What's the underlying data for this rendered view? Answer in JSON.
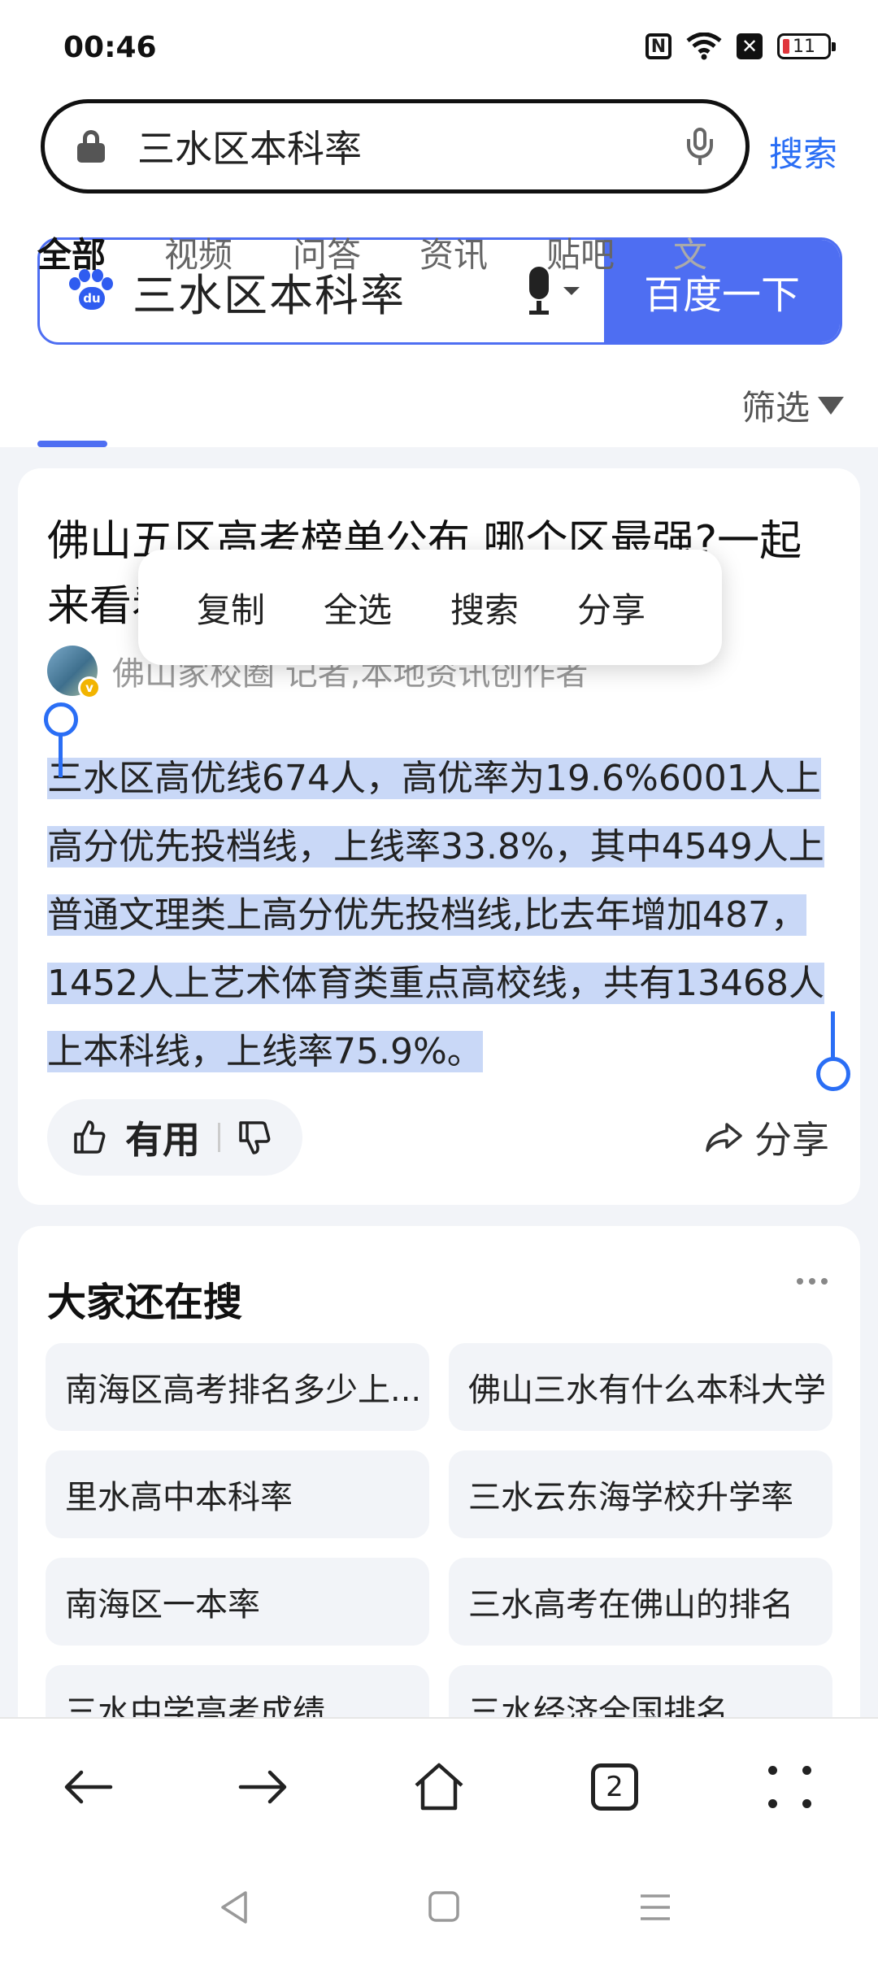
{
  "status_bar": {
    "time": "00:46",
    "battery": "11"
  },
  "browser": {
    "address_text": "三水区本科率",
    "search_button": "搜索"
  },
  "baidu": {
    "query": "三水区本科率",
    "paw_text": "du",
    "submit_label": "百度一下",
    "tabs": [
      "全部",
      "视频",
      "问答",
      "资讯",
      "贴吧",
      "文"
    ],
    "filter_label": "筛选"
  },
  "result": {
    "title": "佛山五区高考榜单公布,哪个区最强?一起来看看",
    "author_badge": "v",
    "author": "佛山家校圈 记者,本地资讯创作者",
    "snippet": "三水区高优线674人，高优率为19.6%6001人上高分优先投档线，上线率33.8%，其中4549人上普通文理类上高分优先投档线,比去年增加487，1452人上艺术体育类重点高校线，共有13468人上本科线，上线率75.9%。",
    "useful_label": "有用",
    "share_label": "分享"
  },
  "context_menu": [
    "复制",
    "全选",
    "搜索",
    "分享"
  ],
  "related": {
    "title": "大家还在搜",
    "items": [
      "南海区高考排名多少上...",
      "佛山三水有什么本科大学",
      "里水高中本科率",
      "三水云东海学校升学率",
      "南海区一本率",
      "三水高考在佛山的排名",
      "三水中学高考成绩",
      "三水经济全国排名"
    ]
  },
  "toolbar": {
    "tab_count": "2"
  },
  "colors": {
    "accent": "#4e6ef2",
    "link_blue": "#2a6ef5",
    "selection": "#c9d8f7"
  }
}
